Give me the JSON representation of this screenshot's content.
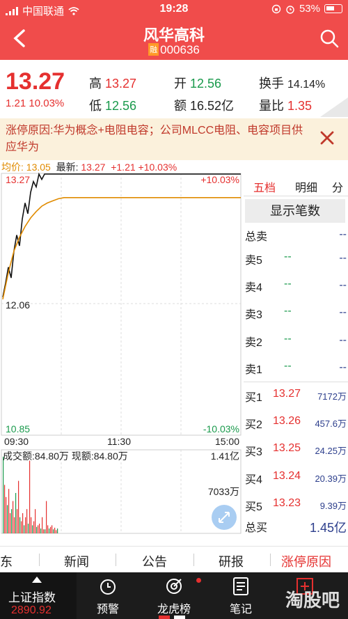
{
  "status_bar": {
    "carrier": "中国联通",
    "time": "19:28",
    "battery": "53%"
  },
  "header": {
    "title": "风华高科",
    "badge": "融",
    "code": "000636"
  },
  "quote": {
    "price": "13.27",
    "change": "1.21",
    "change_pct": "10.03%",
    "high_label": "高",
    "high": "13.27",
    "low_label": "低",
    "low": "12.56",
    "open_label": "开",
    "open": "12.56",
    "amount_label": "额",
    "amount": "16.52亿",
    "turnover_label": "换手",
    "turnover": "14.14%",
    "volratio_label": "量比",
    "volratio": "1.35"
  },
  "limit_reason": {
    "text": "涨停原因:华为概念+电阻电容；公司MLCC电阻、电容项目供应华为"
  },
  "intraday": {
    "avg_label": "均价:",
    "avg": "13.05",
    "latest_label": "最新:",
    "latest": "13.27",
    "chg": "+1.21",
    "chg_pct": "+10.03%"
  },
  "chart_data": {
    "type": "line",
    "title": "",
    "ylim": [
      10.85,
      13.27
    ],
    "y_labels": {
      "top": "13.27",
      "mid": "12.06",
      "bottom": "10.85"
    },
    "pct_labels": {
      "top": "+10.03%",
      "bottom": "-10.03%"
    },
    "x_labels": [
      "09:30",
      "11:30",
      "15:00"
    ],
    "price_series": [
      12.12,
      12.25,
      12.4,
      12.3,
      12.55,
      12.7,
      12.6,
      12.85,
      13.0,
      12.9,
      13.1,
      13.2,
      13.15,
      13.27,
      13.22,
      13.27
    ],
    "avg_series": [
      12.1,
      12.35,
      12.55,
      12.68,
      12.78,
      12.86,
      12.92,
      12.97,
      13.0,
      13.02,
      13.04,
      13.05
    ],
    "volume": {
      "label": "成交额:",
      "value": "84.80万",
      "now_label": "现额:",
      "now_value": "84.80万",
      "max": "1.41亿",
      "mid": "7033万",
      "bars": [
        0.95,
        0.6,
        0.45,
        0.35,
        0.55,
        0.25,
        0.3,
        0.4,
        0.2,
        0.5,
        0.3,
        0.65,
        0.2,
        0.15,
        0.25,
        0.1,
        0.2,
        0.3,
        0.12,
        0.9,
        0.2,
        0.1,
        0.15,
        0.3,
        0.08,
        0.1,
        0.12,
        0.06,
        0.2,
        0.05,
        0.05,
        0.4,
        0.1,
        0.06,
        0.08,
        0.1,
        0.05,
        0.07,
        0.04,
        0.06
      ]
    }
  },
  "orderbook": {
    "tabs": [
      "五档",
      "明细",
      "分"
    ],
    "show_button": "显示笔数",
    "total_sell_label": "总卖",
    "total_sell": "--",
    "sells": [
      {
        "label": "卖5",
        "price": "--",
        "qty": "--"
      },
      {
        "label": "卖4",
        "price": "--",
        "qty": "--"
      },
      {
        "label": "卖3",
        "price": "--",
        "qty": "--"
      },
      {
        "label": "卖2",
        "price": "--",
        "qty": "--"
      },
      {
        "label": "卖1",
        "price": "--",
        "qty": "--"
      }
    ],
    "buys": [
      {
        "label": "买1",
        "price": "13.27",
        "qty": "7172万"
      },
      {
        "label": "买2",
        "price": "13.26",
        "qty": "457.6万"
      },
      {
        "label": "买3",
        "price": "13.25",
        "qty": "24.25万"
      },
      {
        "label": "买4",
        "price": "13.24",
        "qty": "20.39万"
      },
      {
        "label": "买5",
        "price": "13.23",
        "qty": "9.39万"
      }
    ],
    "total_buy_label": "总买",
    "total_buy": "1.45亿"
  },
  "nav_tabs": [
    "东",
    "新闻",
    "公告",
    "研报",
    "涨停原因"
  ],
  "bottom_nav": {
    "index_name": "上证指数",
    "index_value": "2890.92",
    "items": [
      "预警",
      "龙虎榜",
      "笔记"
    ],
    "watermark": "淘股吧"
  },
  "colors": {
    "header": "#f04c4b",
    "up": "#e5302f",
    "down": "#1a9a4c",
    "avg": "#e08b00"
  }
}
